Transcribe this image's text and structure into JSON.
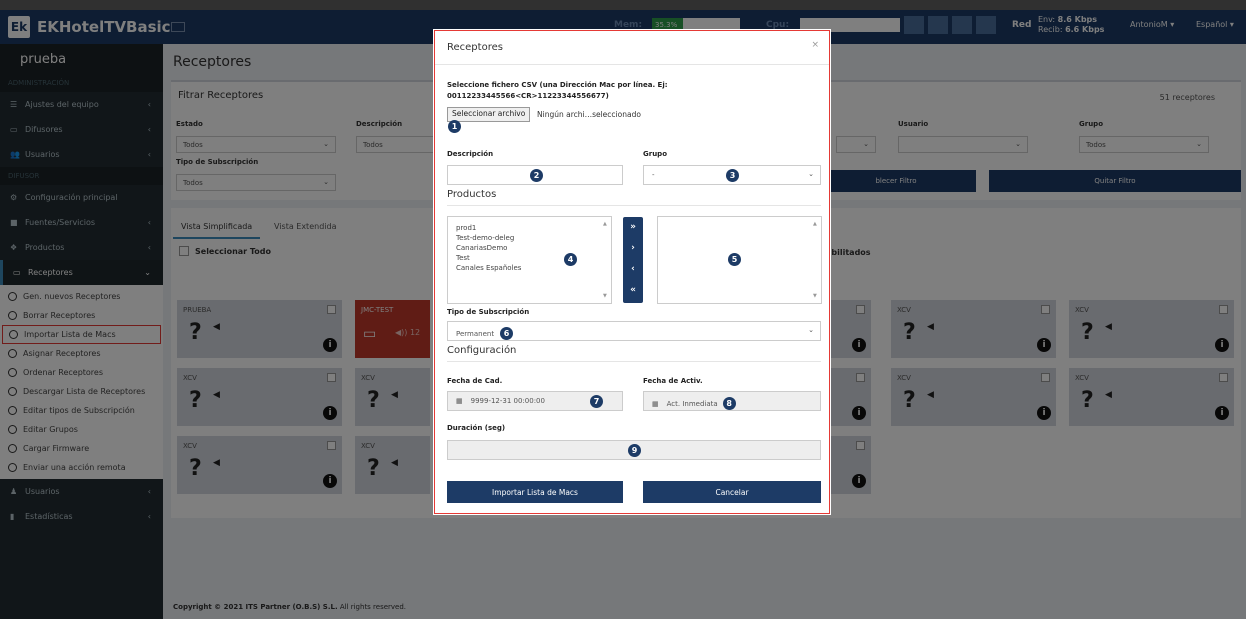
{
  "app": {
    "logo": "Ek",
    "title": "EKHotelTVBasic"
  },
  "topbar": {
    "mem_label": "Mem:",
    "mem_value": "35.3%",
    "mem_fraction": 0.353,
    "cpu_label": "Cpu:",
    "red_label": "Red",
    "env_label": "Env:",
    "env_value": "8.6 Kbps",
    "recib_label": "Recib:",
    "recib_value": "6.6 Kbps",
    "user": "AntonioM ▾",
    "language": "Español ▾"
  },
  "sidebar": {
    "header": "prueba",
    "section_admin": "ADMINISTRACIÓN",
    "admin_items": [
      {
        "icon": "sliders-icon",
        "label": "Ajustes del equipo",
        "glyph": "☰"
      },
      {
        "icon": "monitor-icon",
        "label": "Difusores",
        "glyph": "▭"
      },
      {
        "icon": "users-icon",
        "label": "Usuarios",
        "glyph": "👥"
      }
    ],
    "section_difusor": "DIFUSOR",
    "difusor_items": [
      {
        "icon": "gears-icon",
        "label": "Configuración principal",
        "glyph": "⚙"
      },
      {
        "icon": "film-icon",
        "label": "Fuentes/Servicios",
        "glyph": "■"
      },
      {
        "icon": "cubes-icon",
        "label": "Productos",
        "glyph": "❖"
      },
      {
        "icon": "hdd-icon",
        "label": "Receptores",
        "glyph": "▭"
      }
    ],
    "receptores_sub": [
      "Gen. nuevos Receptores",
      "Borrar Receptores",
      "Importar Lista de Macs",
      "Asignar Receptores",
      "Ordenar Receptores",
      "Descargar Lista de Receptores",
      "Editar tipos de Subscripción",
      "Editar Grupos",
      "Cargar Firmware",
      "Enviar una acción remota"
    ],
    "bottom_items": [
      {
        "icon": "user-icon",
        "label": "Usuarios",
        "glyph": "♟"
      },
      {
        "icon": "bar-chart-icon",
        "label": "Estadísticas",
        "glyph": "▮"
      }
    ]
  },
  "page": {
    "title": "Receptores",
    "filter_title": "Fitrar Receptores",
    "count": "51 receptores",
    "filters": {
      "estado_label": "Estado",
      "estado_value": "Todos",
      "descripcion_label": "Descripción",
      "descripcion_value": "Todos",
      "usuario_label": "Usuario",
      "grupo_label": "Grupo",
      "grupo_value": "Todos",
      "tipo_label": "Tipo de Subscripción",
      "tipo_value": "Todos",
      "restablecer": "blecer Filtro",
      "quitar": "Quitar Filtro"
    },
    "tabs": [
      "Vista Simplificada",
      "Vista Extendida"
    ],
    "select_all": "Seleccionar Todo",
    "habilitados": "abilitados",
    "cards": [
      {
        "name": "PRUEBA"
      },
      {
        "name": "JMC-TEST"
      },
      {
        "name": "XCV"
      },
      {
        "name": "XCV"
      },
      {
        "name": "XCV"
      },
      {
        "name": "XCV"
      },
      {
        "name": "XCV"
      },
      {
        "name": "XCV"
      },
      {
        "name": "XCV"
      },
      {
        "name": "XCV"
      }
    ],
    "jmc_text": "◀)) 12",
    "footer_prefix": "Copyright © 2021 ",
    "footer_company": "ITS Partner (O.B.S) S.L.",
    "footer_suffix": " All rights reserved."
  },
  "modal": {
    "title": "Receptores",
    "close": "×",
    "csv_label": "Seleccione fichero CSV (una Dirección Mac por línea. Ej:",
    "csv_example": "00112233445566<CR>11223344556677)",
    "file_button": "Seleccionar archivo",
    "file_state": "Ningún archi…seleccionado",
    "descripcion_label": "Descripción",
    "grupo_label": "Grupo",
    "grupo_value": "-",
    "productos_section": "Productos",
    "products_available": [
      "prod1",
      "Test-demo-deleg",
      "CanariasDemo",
      "Test",
      "Canales Españoles"
    ],
    "move_buttons": [
      "»",
      "›",
      "‹",
      "«"
    ],
    "tipo_label": "Tipo de Subscripción",
    "tipo_value": "Permanent",
    "config_section": "Configuración",
    "fecha_cad_label": "Fecha de Cad.",
    "fecha_cad_value": "9999-12-31 00:00:00",
    "fecha_activ_label": "Fecha de Activ.",
    "fecha_activ_value": "Act. Inmediata",
    "duracion_label": "Duración (seg)",
    "import_button": "Importar Lista de Macs",
    "cancel_button": "Cancelar",
    "badges": [
      "1",
      "2",
      "3",
      "4",
      "5",
      "6",
      "7",
      "8",
      "9"
    ]
  }
}
